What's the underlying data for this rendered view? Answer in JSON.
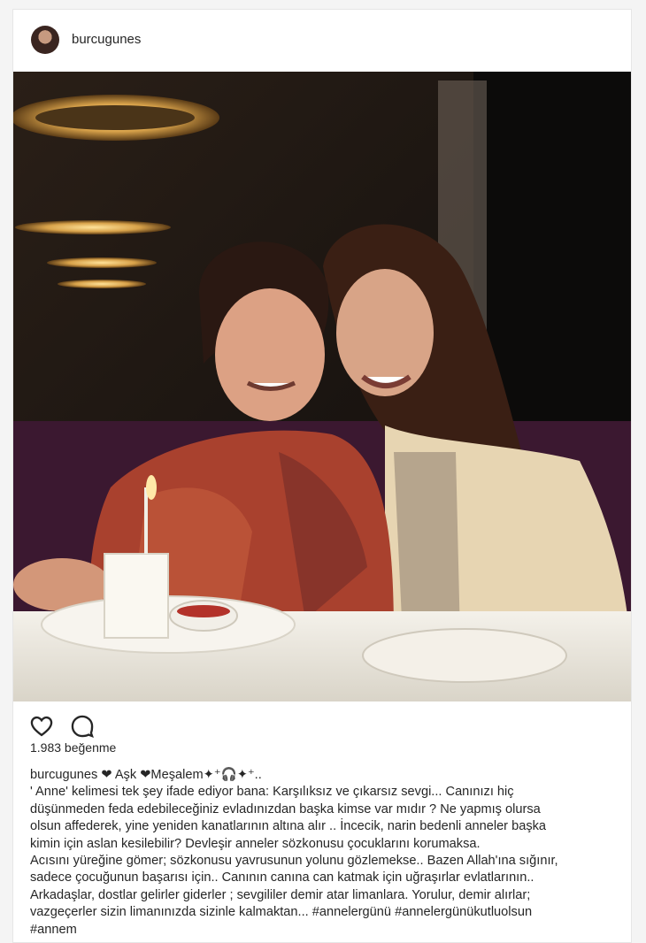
{
  "post": {
    "username": "burcugunes",
    "likes": "1.983 beğenme",
    "caption_user": "burcugunes",
    "caption_first": " ❤ Aşk ❤Meşalem✦⁺🎧✦⁺..",
    "caption_lines": [
      "' Anne' kelimesi tek şey ifade ediyor bana: Karşılıksız ve çıkarsız sevgi... Canınızı hiç",
      "düşünmeden feda edebileceğiniz evladınızdan başka kimse var mıdır ? Ne yapmış olursa",
      "olsun affederek, yine yeniden kanatlarının altına alır .. İncecik, narin bedenli anneler başka",
      "kimin için aslan kesilebilir? Devleşir anneler sözkonusu çocuklarını korumaksa.",
      "Acısını yüreğine gömer; sözkonusu yavrusunun yolunu gözlemekse.. Bazen Allah'ına sığınır,",
      "sadece çocuğunun başarısı için.. Canının canına can katmak için uğraşırlar evlatlarının..",
      "Arkadaşlar, dostlar gelirler giderler ; sevgililer demir atar limanlara. Yorulur, demir alırlar;",
      "vazgeçerler sizin limanınızda sizinle kalmaktan... #annelergünü #annelergünükutluolsun",
      "#annem"
    ]
  },
  "icons": {
    "like": "heart-icon",
    "comment": "comment-icon"
  },
  "colors": {
    "text": "#262626",
    "border": "#e6e6e6",
    "background": "#f4f4f4"
  }
}
